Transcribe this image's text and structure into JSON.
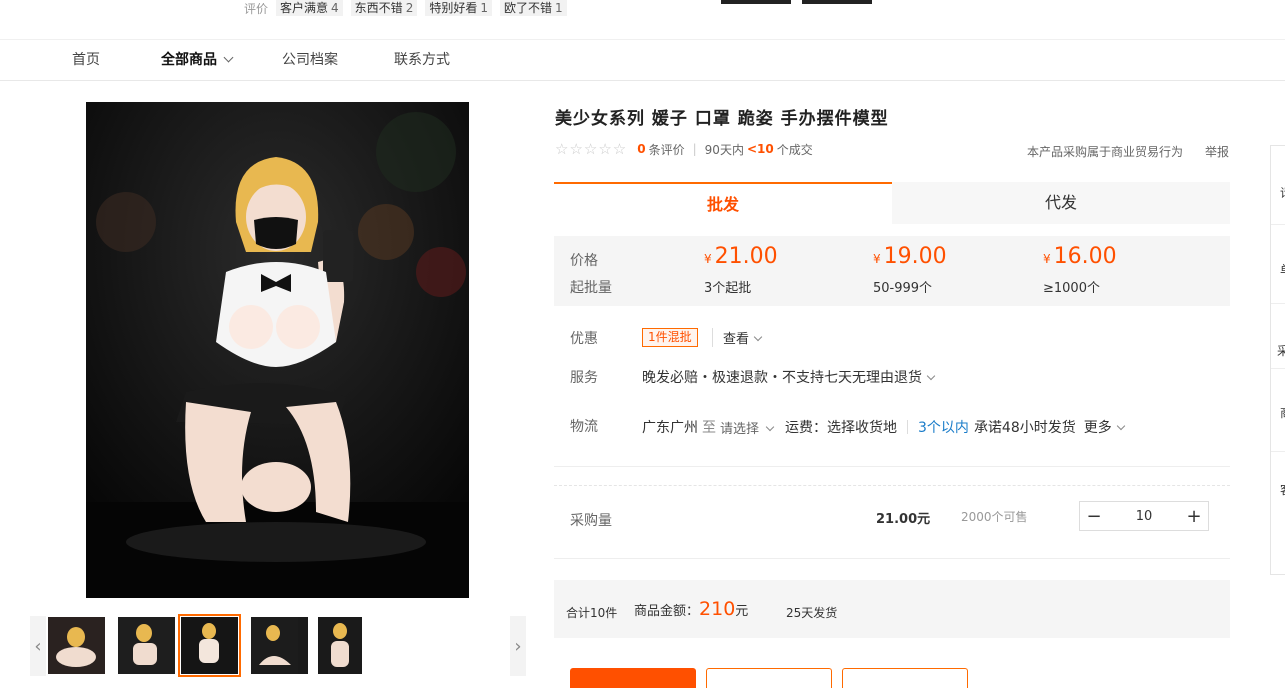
{
  "review_strip": {
    "label": "评价",
    "tags": [
      {
        "text": "客户满意",
        "count": "4"
      },
      {
        "text": "东西不错",
        "count": "2"
      },
      {
        "text": "特别好看",
        "count": "1"
      },
      {
        "text": "欧了不错",
        "count": "1"
      }
    ]
  },
  "nav": {
    "items": [
      "首页",
      "全部商品",
      "公司档案",
      "联系方式"
    ]
  },
  "product": {
    "title": "美少女系列 媛子 口罩 跪姿 手办摆件模型",
    "review_count": "0",
    "review_label": "条评价",
    "period": "90天内",
    "deals": "<10",
    "deals_label": "个成交",
    "trade_note": "本产品采购属于商业贸易行为",
    "report": "举报"
  },
  "tabs": [
    "批发",
    "代发"
  ],
  "price_box": {
    "price_label": "价格",
    "qty_label": "起批量",
    "currency": "¥",
    "tiers": [
      {
        "price": "21.00",
        "qty": "3个起批"
      },
      {
        "price": "19.00",
        "qty": "50-999个"
      },
      {
        "price": "16.00",
        "qty": "≥1000个"
      }
    ]
  },
  "promo": {
    "label": "优惠",
    "tag": "1件混批",
    "view": "查看"
  },
  "service": {
    "label": "服务",
    "text": "晚发必赔・极速退款・不支持七天无理由退货"
  },
  "logistics": {
    "label": "物流",
    "origin": "广东广州",
    "to": "至",
    "select": "请选择",
    "shipping": "运费：选择收货地",
    "ship_time": "3个以内",
    "promise": "承诺48小时发货",
    "more": "更多"
  },
  "purchase": {
    "label": "采购量",
    "unit_price": "21.00元",
    "stock": "2000个可售",
    "quantity": "10",
    "minus": "−",
    "plus": "+"
  },
  "summary": {
    "count": "合计10件",
    "amount_label": "商品金额：",
    "amount": "210",
    "amount_unit": "元",
    "delivery": "25天发货"
  },
  "side_bar": {
    "chars": [
      "请",
      "单",
      "采",
      "商",
      "客"
    ]
  },
  "colors": {
    "accent": "#ff5000",
    "tab_border": "#ff6a00",
    "link_blue": "#1a7cc9"
  },
  "icons": {
    "nav_dropdown": "chevron-down-icon",
    "thumb_prev": "chevron-left-icon",
    "thumb_next": "chevron-right-icon",
    "rating": "star-icon"
  }
}
